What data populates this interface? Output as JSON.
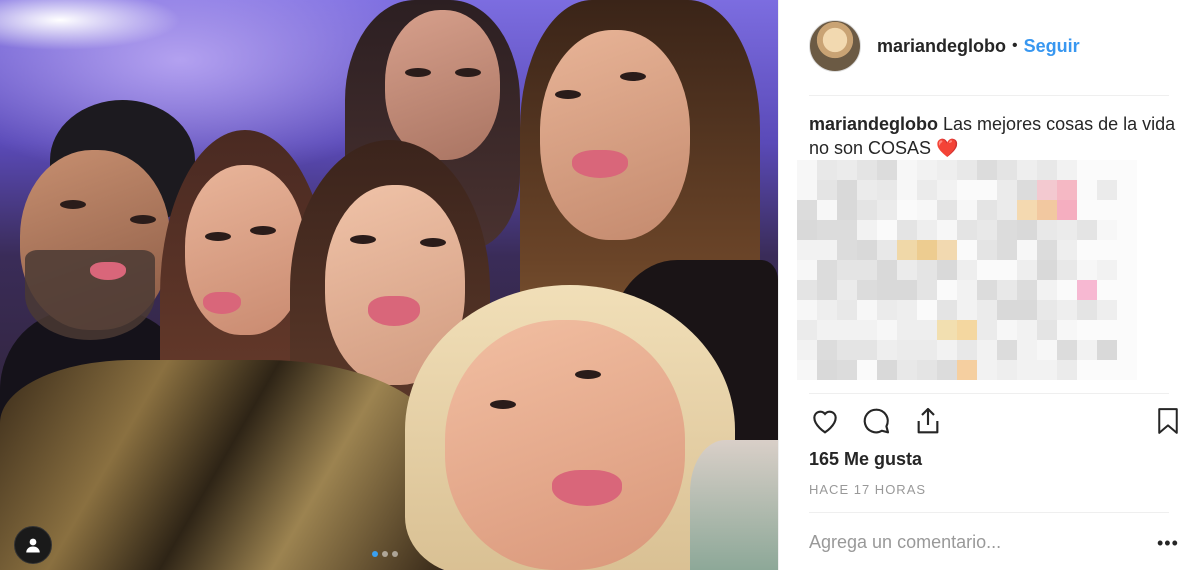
{
  "post": {
    "username": "mariandeglobo",
    "separator": "•",
    "follow_label": "Seguir",
    "caption_text": "Las mejores cosas de la vida no son COSAS ❤️",
    "likes_label": "165 Me gusta",
    "time_label": "HACE 17 HORAS",
    "comment_placeholder": "Agrega un comentario...",
    "more_label": "•••",
    "carousel": {
      "total": 3,
      "current": 1
    }
  },
  "colors": {
    "link": "#3897f0",
    "text": "#262626",
    "muted": "#999999",
    "divider": "#efefef"
  },
  "icons": [
    "heart-icon",
    "comment-icon",
    "share-icon",
    "bookmark-icon",
    "user-tag-icon"
  ]
}
